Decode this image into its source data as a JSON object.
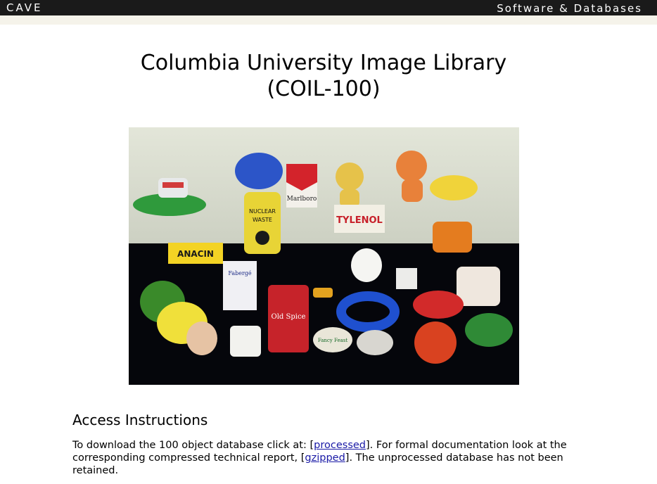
{
  "header": {
    "brand": "CAVE",
    "section": "Software & Databases"
  },
  "title": {
    "line1": "Columbia University Image Library",
    "line2": "(COIL-100)"
  },
  "image": {
    "labels": {
      "tylenol": "TYLENOL",
      "anacin": "ANACIN",
      "marlboro": "Marlboro",
      "nuclear_waste_1": "NUCLEAR",
      "nuclear_waste_2": "WASTE",
      "old_spice": "Old Spice",
      "fancy_feast": "Fancy Feast",
      "faberge": "Fabergé"
    }
  },
  "access": {
    "heading": "Access Instructions",
    "text_1": "To download the 100 object database click at: [",
    "link_processed": "processed",
    "text_2": "]. For formal documentation look at the corresponding compressed technical report, [",
    "link_gzipped": "gzipped",
    "text_3": "]. The unprocessed database has not been retained."
  }
}
